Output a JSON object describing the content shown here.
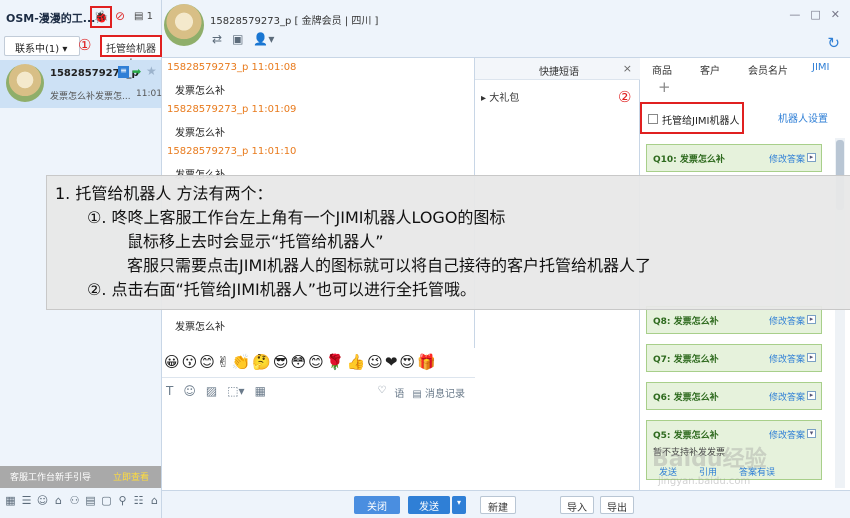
{
  "sidebar": {
    "title": "OSM-漫漫的工...",
    "count": "1",
    "tab_label": "联系中(1)",
    "marker_1": "①",
    "bot_button": "托管给机器人",
    "contact": {
      "name": "15828579273_p",
      "last_message": "发票怎么补发票怎...",
      "time": "11:01"
    },
    "guide_text": "客服工作台新手引导",
    "guide_link": "立即查看"
  },
  "header": {
    "title": "15828579273_p [ 金牌会员 | 四川 ]",
    "window_controls": [
      "—",
      "□",
      "✕"
    ]
  },
  "chat": {
    "messages": [
      {
        "sender": "15828579273_p  11:01:08",
        "text": "发票怎么补"
      },
      {
        "sender": "15828579273_p  11:01:09",
        "text": "发票怎么补"
      },
      {
        "sender": "15828579273_p  11:01:10",
        "text": "发票怎么补"
      }
    ],
    "last_text": "发票怎么补",
    "emojis": [
      "😀",
      "😗",
      "😊",
      "✌",
      "👏",
      "🤔",
      "😎",
      "😳",
      "😊",
      "🌹",
      "👍",
      "😉",
      "❤",
      "😍",
      "🎁"
    ],
    "tools_right": {
      "favorites": "语",
      "records": "消息记录"
    }
  },
  "quick_phrases": {
    "title": "快捷短语",
    "close": "×",
    "item": "大礼包"
  },
  "right_panel": {
    "tabs": [
      "商品",
      "客户",
      "会员名片",
      "JIMI"
    ],
    "marker_2": "②",
    "bot_checkbox_label": "托管给JIMI机器人",
    "settings_link": "机器人设置",
    "faqs": [
      {
        "q": "Q10: 发票怎么补",
        "edit": "修改答案"
      },
      {
        "q": "Q8: 发票怎么补",
        "edit": "修改答案"
      },
      {
        "q": "Q7: 发票怎么补",
        "edit": "修改答案"
      },
      {
        "q": "Q6: 发票怎么补",
        "edit": "修改答案"
      },
      {
        "q": "Q5: 发票怎么补",
        "edit": "修改答案",
        "answer": "暂不支持补发发票",
        "buttons": [
          "发送",
          "引用",
          "答案有误"
        ]
      }
    ]
  },
  "buttons": {
    "close": "关闭",
    "send": "发送",
    "new": "新建",
    "import": "导入",
    "export": "导出"
  },
  "annotation": {
    "line1": "1.  托管给机器人   方法有两个：",
    "line2": "①. 咚咚上客服工作台左上角有一个JIMI机器人LOGO的图标",
    "line3": "鼠标移上去时会显示“托管给机器人”",
    "line4": "客服只需要点击JIMI机器人的图标就可以将自己接待的客户托管给机器人了",
    "line5": "②. 点击右面“托管给JIMI机器人”也可以进行全托管哦。"
  },
  "watermark": {
    "text": "Baidu经验",
    "url": "jingyan.baidu.com"
  }
}
